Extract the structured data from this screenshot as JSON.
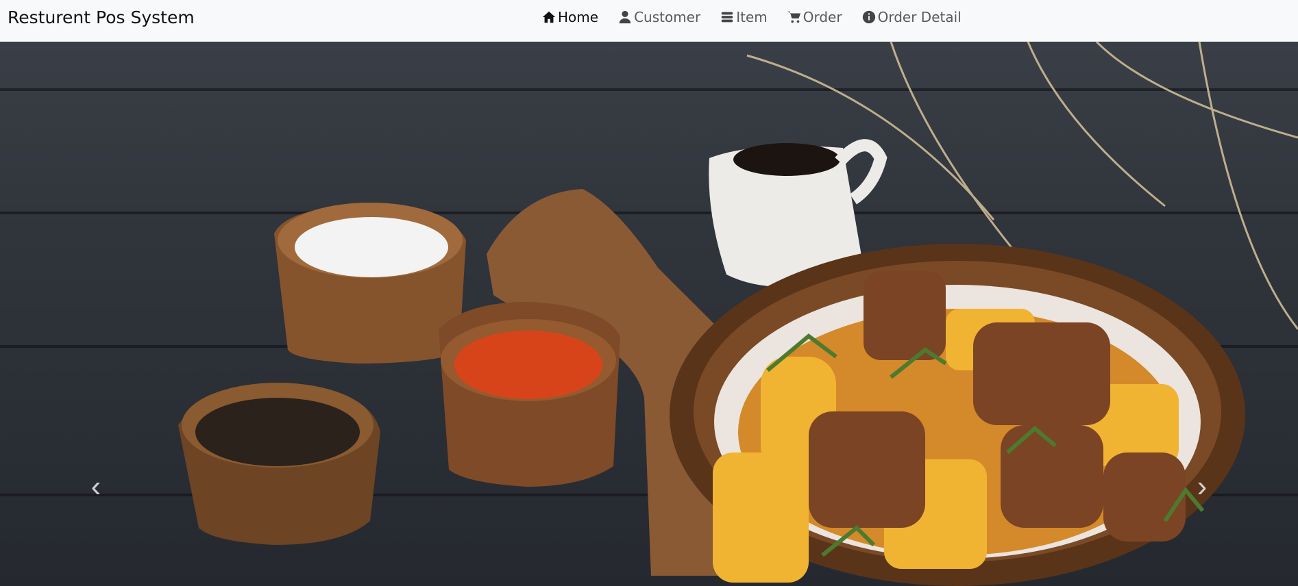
{
  "app": {
    "brand": "Resturent Pos System"
  },
  "nav": {
    "items": [
      {
        "label": "Home",
        "icon": "home-icon",
        "active": true
      },
      {
        "label": "Customer",
        "icon": "user-icon"
      },
      {
        "label": "Item",
        "icon": "item-stack-icon"
      },
      {
        "label": "Order",
        "icon": "cart-icon"
      },
      {
        "label": "Order Detail",
        "icon": "info-circle-icon"
      }
    ]
  },
  "carousel": {
    "image": "food-banner-image",
    "prev": "‹",
    "next": "›"
  }
}
